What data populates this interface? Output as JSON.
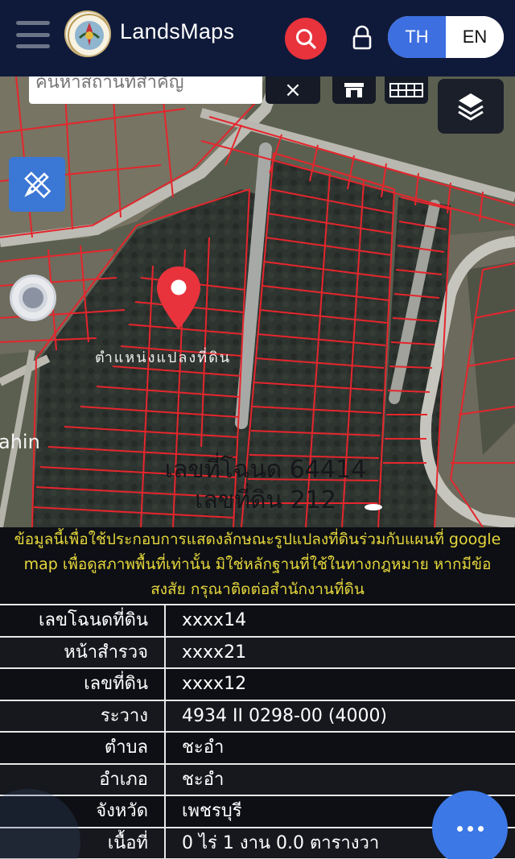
{
  "header": {
    "app_title": "LandsMaps",
    "menu_icon": "hamburger-icon",
    "logo_icon": "department-seal-logo",
    "search_icon": "search-icon",
    "lock_icon": "lock-icon",
    "languages": [
      "TH",
      "EN"
    ],
    "active_language": "TH"
  },
  "map": {
    "search_placeholder": "ค้นหาสถานที่สำคัญ",
    "clear_label": "×",
    "parcel_caption": "ตำแหน่งแปลงที่ดิน",
    "deed_line": "เลขที่โฉนด 64414",
    "land_line": "เลขที่ดิน 212",
    "place_fragment": "ahin",
    "colors": {
      "parcel_lines": "#e5262d",
      "pin": "#e8333d",
      "accent": "#3d6fe0"
    }
  },
  "notice": {
    "text": "ข้อมูลนี้เพื่อใช้ประกอบการแสดงลักษณะรูปแปลงที่ดินร่วมกับแผนที่ google map เพื่อดูสภาพพื้นที่เท่านั้น มิใช่หลักฐานที่ใช้ในทางกฎหมาย หากมีข้อสงสัย กรุณาติดต่อสำนักงานที่ดิน"
  },
  "info": {
    "rows": [
      {
        "label": "เลขโฉนดที่ดิน",
        "value": "xxxx14"
      },
      {
        "label": "หน้าสำรวจ",
        "value": "xxxx21"
      },
      {
        "label": "เลขที่ดิน",
        "value": "xxxx12"
      },
      {
        "label": "ระวาง",
        "value": "4934 II 0298-00 (4000)"
      },
      {
        "label": "ตำบล",
        "value": "ชะอำ"
      },
      {
        "label": "อำเภอ",
        "value": "ชะอำ"
      },
      {
        "label": "จังหวัด",
        "value": "เพชรบุรี"
      },
      {
        "label": "เนื้อที่",
        "value": "0 ไร่ 1 งาน 0.0 ตารางวา"
      }
    ]
  },
  "fab": {
    "icon": "more-horizontal-icon"
  }
}
